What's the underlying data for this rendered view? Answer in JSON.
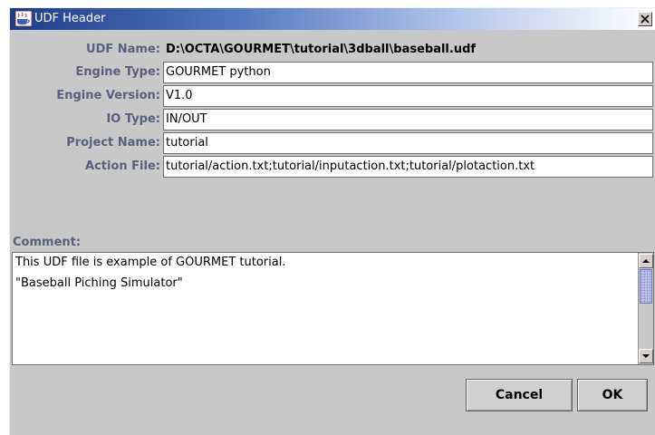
{
  "window": {
    "title": "UDF Header"
  },
  "form": {
    "udf_name_label": "UDF Name:",
    "udf_name_value": "D:\\OCTA\\GOURMET\\tutorial\\3dball\\baseball.udf",
    "engine_type_label": "Engine Type:",
    "engine_type_value": "GOURMET python",
    "engine_version_label": "Engine Version:",
    "engine_version_value": "V1.0",
    "io_type_label": "IO Type:",
    "io_type_value": "IN/OUT",
    "project_name_label": "Project Name:",
    "project_name_value": "tutorial",
    "action_file_label": "Action File:",
    "action_file_value": "tutorial/action.txt;tutorial/inputaction.txt;tutorial/plotaction.txt"
  },
  "comment": {
    "label": "Comment:",
    "lines": [
      "This UDF file is example of GOURMET tutorial.",
      "\"Baseball Piching Simulator\""
    ]
  },
  "buttons": {
    "cancel_label": "Cancel",
    "ok_label": "OK"
  },
  "icons": {
    "app": "java-coffee-cup-icon",
    "close": "close-icon",
    "scroll_up": "arrow-up-icon",
    "scroll_down": "arrow-down-icon"
  },
  "colors": {
    "title_gradient_start": "#1c3d8c",
    "label_text": "#5a607e",
    "dialog_background": "#c8c8c8"
  }
}
